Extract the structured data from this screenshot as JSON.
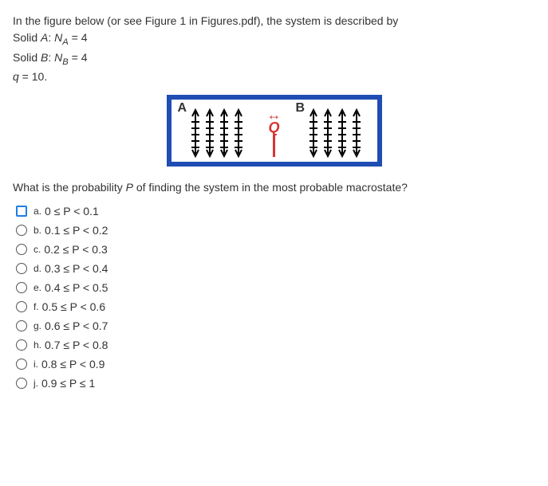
{
  "intro": {
    "line1_prefix": "In the figure below (or see Figure 1 in Figures.pdf), the system is described by",
    "solidA_prefix": "Solid ",
    "solidA_var": "A",
    "solidA_colon": ": ",
    "solidA_N": "N",
    "solidA_sub": "A",
    "solidA_eq": " = 4",
    "solidB_prefix": "Solid ",
    "solidB_var": "B",
    "solidB_colon": ": ",
    "solidB_N": "N",
    "solidB_sub": "B",
    "solidB_eq": " = 4",
    "q_line_var": "q",
    "q_line_eq": " = 10."
  },
  "figure": {
    "labelA": "A",
    "labelB": "B",
    "q_arrow": "↔",
    "q_label": "Q"
  },
  "question": {
    "prefix": "What is the probability ",
    "P": "P",
    "suffix": " of finding the system in the most probable macrostate?"
  },
  "options": [
    {
      "letter": "a.",
      "text": "0 ≤ P < 0.1",
      "selected": true
    },
    {
      "letter": "b.",
      "text": "0.1 ≤ P < 0.2",
      "selected": false
    },
    {
      "letter": "c.",
      "text": "0.2 ≤ P < 0.3",
      "selected": false
    },
    {
      "letter": "d.",
      "text": "0.3 ≤ P < 0.4",
      "selected": false
    },
    {
      "letter": "e.",
      "text": "0.4 ≤ P < 0.5",
      "selected": false
    },
    {
      "letter": "f.",
      "text": "0.5 ≤ P < 0.6",
      "selected": false
    },
    {
      "letter": "g.",
      "text": "0.6 ≤ P < 0.7",
      "selected": false
    },
    {
      "letter": "h.",
      "text": "0.7 ≤ P < 0.8",
      "selected": false
    },
    {
      "letter": "i.",
      "text": "0.8 ≤ P < 0.9",
      "selected": false
    },
    {
      "letter": "j.",
      "text": "0.9 ≤ P ≤ 1",
      "selected": false
    }
  ]
}
